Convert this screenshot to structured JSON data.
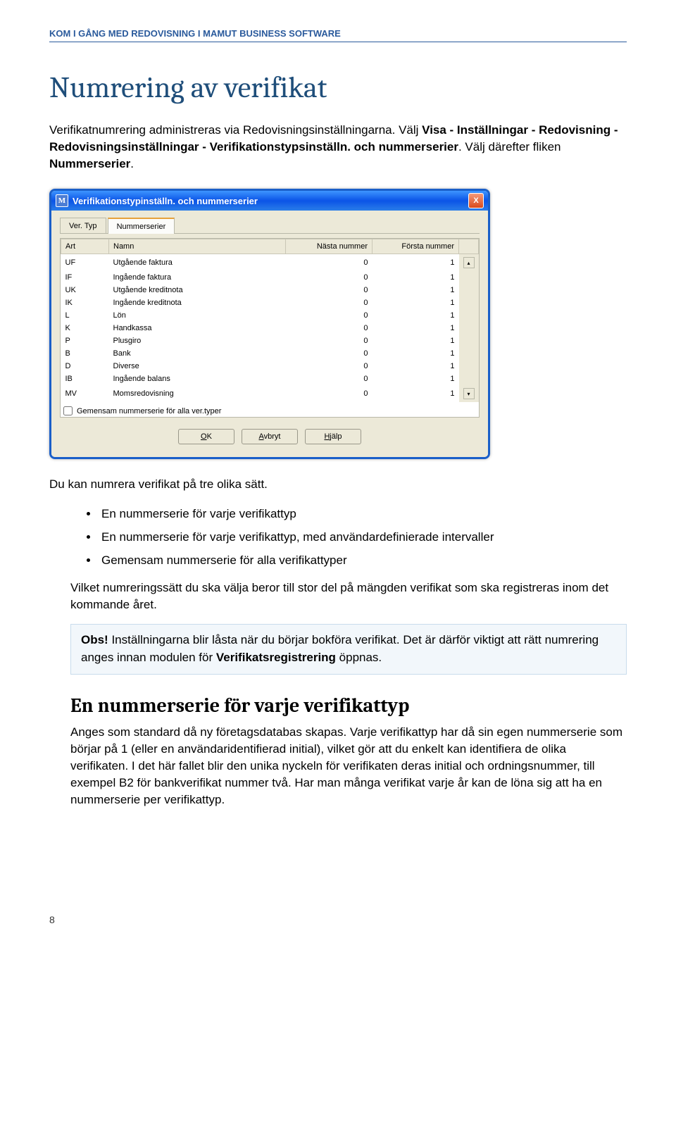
{
  "header": "KOM I GÅNG MED REDOVISNING I MAMUT BUSINESS SOFTWARE",
  "h1": "Numrering av verifikat",
  "intro": {
    "p1_a": "Verifikatnumrering administreras via Redovisningsinställningarna. Välj ",
    "p1_b": "Visa - Inställningar - Redovisning - Redovisningsinställningar - Verifikationstypsinställn. och nummerserier",
    "p1_c": ". Välj därefter fliken ",
    "p1_d": "Nummerserier",
    "p1_e": "."
  },
  "dialog": {
    "title": "Verifikationstypinställn. och nummerserier",
    "close_label": "X",
    "tabs": {
      "t1": "Ver. Typ",
      "t2": "Nummerserier"
    },
    "columns": {
      "art": "Art",
      "namn": "Namn",
      "nasta": "Nästa nummer",
      "forsta": "Första nummer"
    },
    "rows": [
      {
        "art": "UF",
        "namn": "Utgående faktura",
        "nasta": "0",
        "forsta": "1"
      },
      {
        "art": "IF",
        "namn": "Ingående faktura",
        "nasta": "0",
        "forsta": "1"
      },
      {
        "art": "UK",
        "namn": "Utgående kreditnota",
        "nasta": "0",
        "forsta": "1"
      },
      {
        "art": "IK",
        "namn": "Ingående kreditnota",
        "nasta": "0",
        "forsta": "1"
      },
      {
        "art": "L",
        "namn": "Lön",
        "nasta": "0",
        "forsta": "1"
      },
      {
        "art": "K",
        "namn": "Handkassa",
        "nasta": "0",
        "forsta": "1"
      },
      {
        "art": "P",
        "namn": "Plusgiro",
        "nasta": "0",
        "forsta": "1"
      },
      {
        "art": "B",
        "namn": "Bank",
        "nasta": "0",
        "forsta": "1"
      },
      {
        "art": "D",
        "namn": "Diverse",
        "nasta": "0",
        "forsta": "1"
      },
      {
        "art": "IB",
        "namn": "Ingående balans",
        "nasta": "0",
        "forsta": "1"
      },
      {
        "art": "MV",
        "namn": "Momsredovisning",
        "nasta": "0",
        "forsta": "1"
      }
    ],
    "checkbox_label": "Gemensam nummerserie för alla ver.typer",
    "buttons": {
      "ok": "OK",
      "ok_u": "O",
      "cancel_u": "A",
      "cancel_rest": "vbryt",
      "help_u": "H",
      "help_rest": "jälp"
    }
  },
  "body2": "Du kan numrera verifikat på tre olika sätt.",
  "bullets": [
    "En nummerserie för varje verifikattyp",
    "En nummerserie för varje verifikattyp, med användardefinierade intervaller",
    "Gemensam nummerserie för alla verifikattyper"
  ],
  "follow": "Vilket numreringssätt du ska välja beror till stor del på mängden verifikat som ska registreras inom det kommande året.",
  "callout": {
    "lead": "Obs!",
    "text_a": " Inställningarna blir låsta när du börjar bokföra verifikat. Det är därför viktigt att rätt numrering anges innan modulen för ",
    "text_b": "Verifikatsregistrering",
    "text_c": " öppnas."
  },
  "h2": "En nummerserie för varje verifikattyp",
  "section": "Anges som standard då ny företagsdatabas skapas. Varje verifikattyp har då sin egen nummerserie som börjar på 1 (eller en användaridentifierad initial), vilket gör att du enkelt kan identifiera de olika verifikaten. I det här fallet blir den unika nyckeln för verifikaten deras initial och ordningsnummer, till exempel B2 för bankverifikat nummer två. Har man många verifikat varje år kan de löna sig att ha en nummerserie per verifikattyp.",
  "page_num": "8"
}
